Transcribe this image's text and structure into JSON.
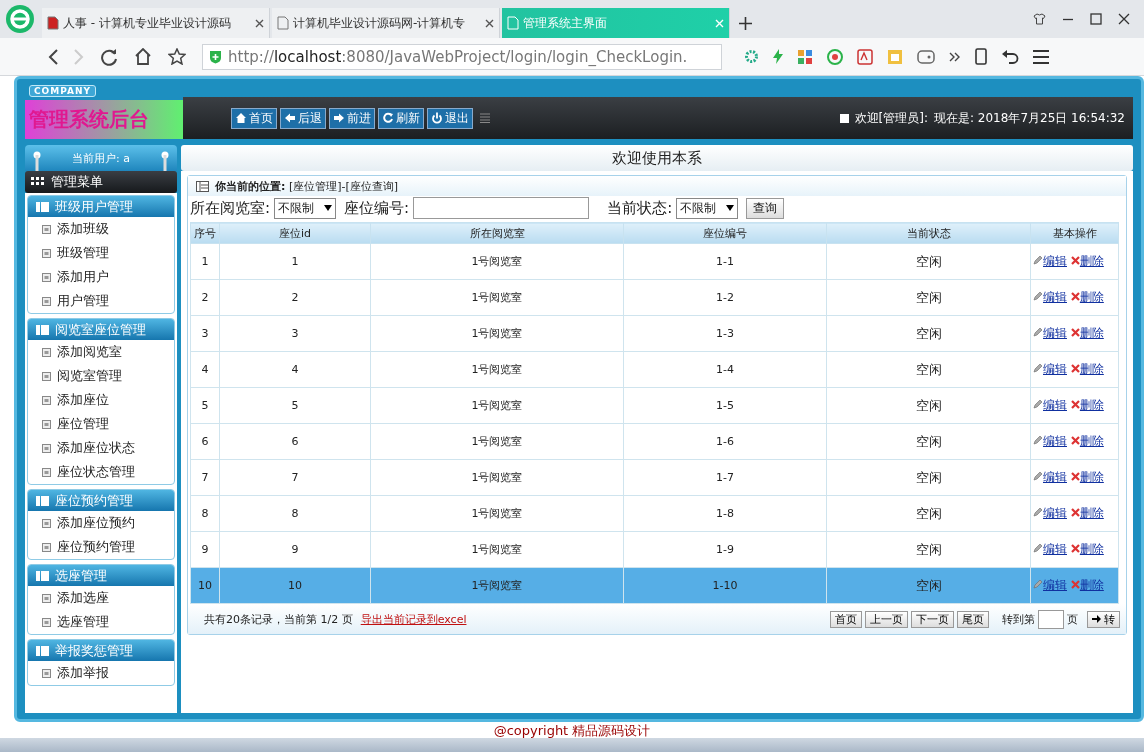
{
  "browser": {
    "tabs": [
      {
        "title": "人事 - 计算机专业毕业设计源码",
        "selected": false
      },
      {
        "title": "计算机毕业设计源码网-计算机专",
        "selected": false
      },
      {
        "title": "管理系统主界面",
        "selected": true
      }
    ],
    "url": "http://**localhost**:8080/JavaWebProject/login/login_CheckLogin."
  },
  "header": {
    "company": "COMPANY",
    "title": "管理系统后台",
    "nav_buttons": [
      "首页",
      "后退",
      "前进",
      "刷新",
      "退出"
    ],
    "greeting": "欢迎[管理员]:",
    "datetime": "现在是: 2018年7月25日 16:54:32"
  },
  "sidebar": {
    "current_user": "当前用户: a",
    "menu_title": "管理菜单",
    "groups": [
      {
        "title": "班级用户管理",
        "items": [
          "添加班级",
          "班级管理",
          "添加用户",
          "用户管理"
        ]
      },
      {
        "title": "阅览室座位管理",
        "items": [
          "添加阅览室",
          "阅览室管理",
          "添加座位",
          "座位管理",
          "添加座位状态",
          "座位状态管理"
        ]
      },
      {
        "title": "座位预约管理",
        "items": [
          "添加座位预约",
          "座位预约管理"
        ]
      },
      {
        "title": "选座管理",
        "items": [
          "添加选座",
          "选座管理"
        ]
      },
      {
        "title": "举报奖惩管理",
        "items": [
          "添加举报"
        ]
      }
    ]
  },
  "main": {
    "title": "欢迎使用本系",
    "breadcrumb": "**你当前的位置:** [座位管理]-[座位查询]",
    "filters": [
      {
        "kind": "select",
        "label": "所在阅览室:",
        "value": "不限制"
      },
      {
        "kind": "input",
        "label": "座位编号:"
      },
      {
        "kind": "select",
        "label": "当前状态:",
        "value": "不限制"
      }
    ],
    "search_button": "查询",
    "table": {
      "columns": [
        "序号",
        "座位id",
        "所在阅览室",
        "座位编号",
        "当前状态",
        "基本操作"
      ],
      "rows": [
        {
          "cells": [
            "1",
            "1",
            "1号阅览室",
            "1-1",
            "空闲"
          ],
          "actions": [
            "编辑",
            "删除"
          ],
          "selected": false
        },
        {
          "cells": [
            "2",
            "2",
            "1号阅览室",
            "1-2",
            "空闲"
          ],
          "actions": [
            "编辑",
            "删除"
          ],
          "selected": false
        },
        {
          "cells": [
            "3",
            "3",
            "1号阅览室",
            "1-3",
            "空闲"
          ],
          "actions": [
            "编辑",
            "删除"
          ],
          "selected": false
        },
        {
          "cells": [
            "4",
            "4",
            "1号阅览室",
            "1-4",
            "空闲"
          ],
          "actions": [
            "编辑",
            "删除"
          ],
          "selected": false
        },
        {
          "cells": [
            "5",
            "5",
            "1号阅览室",
            "1-5",
            "空闲"
          ],
          "actions": [
            "编辑",
            "删除"
          ],
          "selected": false
        },
        {
          "cells": [
            "6",
            "6",
            "1号阅览室",
            "1-6",
            "空闲"
          ],
          "actions": [
            "编辑",
            "删除"
          ],
          "selected": false
        },
        {
          "cells": [
            "7",
            "7",
            "1号阅览室",
            "1-7",
            "空闲"
          ],
          "actions": [
            "编辑",
            "删除"
          ],
          "selected": false
        },
        {
          "cells": [
            "8",
            "8",
            "1号阅览室",
            "1-8",
            "空闲"
          ],
          "actions": [
            "编辑",
            "删除"
          ],
          "selected": false
        },
        {
          "cells": [
            "9",
            "9",
            "1号阅览室",
            "1-9",
            "空闲"
          ],
          "actions": [
            "编辑",
            "删除"
          ],
          "selected": false
        },
        {
          "cells": [
            "10",
            "10",
            "1号阅览室",
            "1-10",
            "空闲"
          ],
          "actions": [
            "编辑",
            "删除"
          ],
          "selected": true
        }
      ]
    },
    "footer": {
      "summary": "共有20条记录，当前第 1/2 页",
      "export_link": "导出当前记录到excel",
      "pager": [
        "首页",
        "上一页",
        "下一页",
        "尾页"
      ],
      "goto_label": "转到第",
      "page_unit": "页",
      "go_button": "转"
    }
  },
  "copyright": "@copyright 精品源码设计"
}
